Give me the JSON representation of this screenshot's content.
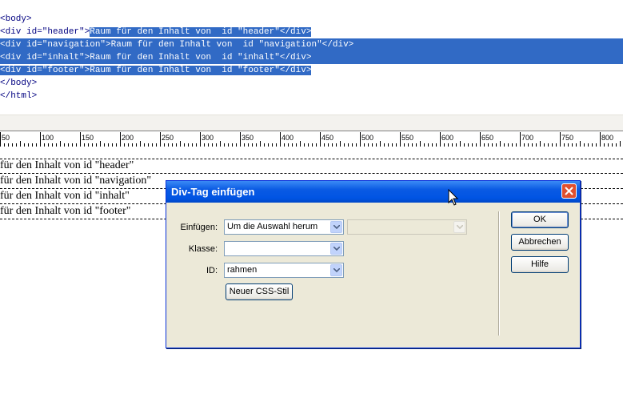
{
  "code": {
    "lines": [
      {
        "text": "<body>"
      },
      {
        "prefix": "<div id=\"header\">",
        "selected": "Raum für den Inhalt von  id \"header\"</div>"
      },
      {
        "selected": "<div id=\"navigation\">Raum für den Inhalt von  id \"navigation\"</div>"
      },
      {
        "selected": "<div id=\"inhalt\">Raum für den Inhalt von  id \"inhalt\"</div>"
      },
      {
        "selected": "<div id=\"footer\">Raum für den Inhalt von  id \"footer\"</div>"
      },
      {
        "text": "</body>"
      },
      {
        "text": "</html>"
      }
    ]
  },
  "ruler": {
    "labels": [
      "50",
      "100",
      "150",
      "200",
      "250",
      "300",
      "350",
      "400",
      "450",
      "500",
      "550",
      "600",
      "650",
      "700",
      "750",
      "800"
    ]
  },
  "design": {
    "rows": [
      "für den Inhalt von id \"header\"",
      "für den Inhalt von id \"navigation\"",
      "für den Inhalt von id \"inhalt\"",
      "für den Inhalt von id \"footer\""
    ]
  },
  "dialog": {
    "title": "Div-Tag einfügen",
    "einfuegen_label": "Einfügen:",
    "einfuegen_value": "Um die Auswahl herum",
    "einfuegen_target_value": "",
    "klasse_label": "Klasse:",
    "klasse_value": "",
    "id_label": "ID:",
    "id_value": "rahmen",
    "new_css_label": "Neuer CSS-Stil",
    "ok_label": "OK",
    "cancel_label": "Abbrechen",
    "help_label": "Hilfe"
  },
  "colors": {
    "selection": "#316ac5",
    "titlebar": "#0054e3",
    "dialog_bg": "#ece9d8",
    "close_button": "#e0502f"
  },
  "icons": {
    "close": "close-icon",
    "dropdown": "chevron-down-icon",
    "cursor": "mouse-pointer-icon"
  }
}
